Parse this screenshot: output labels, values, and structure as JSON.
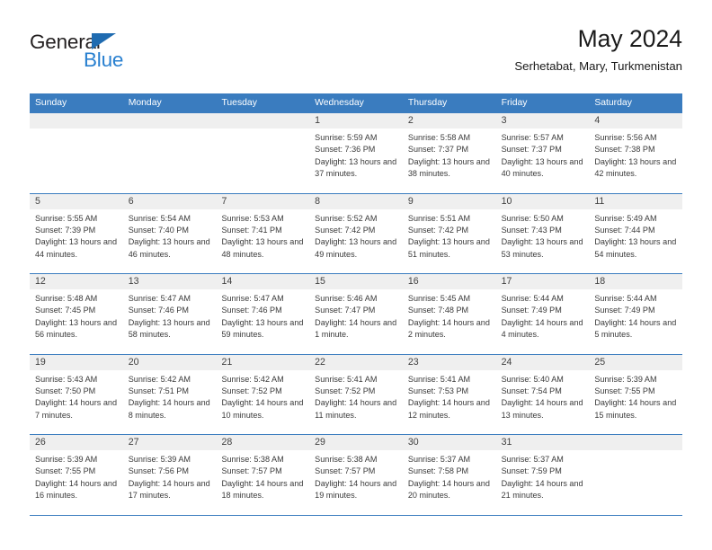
{
  "brand": {
    "name_part1": "General",
    "name_part2": "Blue",
    "triangle_icon": "triangle-icon",
    "colors": {
      "black": "#231f20",
      "blue": "#2980d0",
      "triangle": "#1f6bb0"
    }
  },
  "header": {
    "title": "May 2024",
    "subtitle": "Serhetabat, Mary, Turkmenistan"
  },
  "theme": {
    "header_row_bg": "#3a7cbf",
    "header_row_text": "#ffffff",
    "day_number_bg": "#efefef",
    "row_divider": "#3a7cbf",
    "body_text": "#3a3a3a"
  },
  "weekdays": [
    "Sunday",
    "Monday",
    "Tuesday",
    "Wednesday",
    "Thursday",
    "Friday",
    "Saturday"
  ],
  "weeks": [
    [
      {
        "day": "",
        "info": ""
      },
      {
        "day": "",
        "info": ""
      },
      {
        "day": "",
        "info": ""
      },
      {
        "day": "1",
        "info": "Sunrise: 5:59 AM\nSunset: 7:36 PM\nDaylight: 13 hours and 37 minutes."
      },
      {
        "day": "2",
        "info": "Sunrise: 5:58 AM\nSunset: 7:37 PM\nDaylight: 13 hours and 38 minutes."
      },
      {
        "day": "3",
        "info": "Sunrise: 5:57 AM\nSunset: 7:37 PM\nDaylight: 13 hours and 40 minutes."
      },
      {
        "day": "4",
        "info": "Sunrise: 5:56 AM\nSunset: 7:38 PM\nDaylight: 13 hours and 42 minutes."
      }
    ],
    [
      {
        "day": "5",
        "info": "Sunrise: 5:55 AM\nSunset: 7:39 PM\nDaylight: 13 hours and 44 minutes."
      },
      {
        "day": "6",
        "info": "Sunrise: 5:54 AM\nSunset: 7:40 PM\nDaylight: 13 hours and 46 minutes."
      },
      {
        "day": "7",
        "info": "Sunrise: 5:53 AM\nSunset: 7:41 PM\nDaylight: 13 hours and 48 minutes."
      },
      {
        "day": "8",
        "info": "Sunrise: 5:52 AM\nSunset: 7:42 PM\nDaylight: 13 hours and 49 minutes."
      },
      {
        "day": "9",
        "info": "Sunrise: 5:51 AM\nSunset: 7:42 PM\nDaylight: 13 hours and 51 minutes."
      },
      {
        "day": "10",
        "info": "Sunrise: 5:50 AM\nSunset: 7:43 PM\nDaylight: 13 hours and 53 minutes."
      },
      {
        "day": "11",
        "info": "Sunrise: 5:49 AM\nSunset: 7:44 PM\nDaylight: 13 hours and 54 minutes."
      }
    ],
    [
      {
        "day": "12",
        "info": "Sunrise: 5:48 AM\nSunset: 7:45 PM\nDaylight: 13 hours and 56 minutes."
      },
      {
        "day": "13",
        "info": "Sunrise: 5:47 AM\nSunset: 7:46 PM\nDaylight: 13 hours and 58 minutes."
      },
      {
        "day": "14",
        "info": "Sunrise: 5:47 AM\nSunset: 7:46 PM\nDaylight: 13 hours and 59 minutes."
      },
      {
        "day": "15",
        "info": "Sunrise: 5:46 AM\nSunset: 7:47 PM\nDaylight: 14 hours and 1 minute."
      },
      {
        "day": "16",
        "info": "Sunrise: 5:45 AM\nSunset: 7:48 PM\nDaylight: 14 hours and 2 minutes."
      },
      {
        "day": "17",
        "info": "Sunrise: 5:44 AM\nSunset: 7:49 PM\nDaylight: 14 hours and 4 minutes."
      },
      {
        "day": "18",
        "info": "Sunrise: 5:44 AM\nSunset: 7:49 PM\nDaylight: 14 hours and 5 minutes."
      }
    ],
    [
      {
        "day": "19",
        "info": "Sunrise: 5:43 AM\nSunset: 7:50 PM\nDaylight: 14 hours and 7 minutes."
      },
      {
        "day": "20",
        "info": "Sunrise: 5:42 AM\nSunset: 7:51 PM\nDaylight: 14 hours and 8 minutes."
      },
      {
        "day": "21",
        "info": "Sunrise: 5:42 AM\nSunset: 7:52 PM\nDaylight: 14 hours and 10 minutes."
      },
      {
        "day": "22",
        "info": "Sunrise: 5:41 AM\nSunset: 7:52 PM\nDaylight: 14 hours and 11 minutes."
      },
      {
        "day": "23",
        "info": "Sunrise: 5:41 AM\nSunset: 7:53 PM\nDaylight: 14 hours and 12 minutes."
      },
      {
        "day": "24",
        "info": "Sunrise: 5:40 AM\nSunset: 7:54 PM\nDaylight: 14 hours and 13 minutes."
      },
      {
        "day": "25",
        "info": "Sunrise: 5:39 AM\nSunset: 7:55 PM\nDaylight: 14 hours and 15 minutes."
      }
    ],
    [
      {
        "day": "26",
        "info": "Sunrise: 5:39 AM\nSunset: 7:55 PM\nDaylight: 14 hours and 16 minutes."
      },
      {
        "day": "27",
        "info": "Sunrise: 5:39 AM\nSunset: 7:56 PM\nDaylight: 14 hours and 17 minutes."
      },
      {
        "day": "28",
        "info": "Sunrise: 5:38 AM\nSunset: 7:57 PM\nDaylight: 14 hours and 18 minutes."
      },
      {
        "day": "29",
        "info": "Sunrise: 5:38 AM\nSunset: 7:57 PM\nDaylight: 14 hours and 19 minutes."
      },
      {
        "day": "30",
        "info": "Sunrise: 5:37 AM\nSunset: 7:58 PM\nDaylight: 14 hours and 20 minutes."
      },
      {
        "day": "31",
        "info": "Sunrise: 5:37 AM\nSunset: 7:59 PM\nDaylight: 14 hours and 21 minutes."
      }
    ]
  ]
}
